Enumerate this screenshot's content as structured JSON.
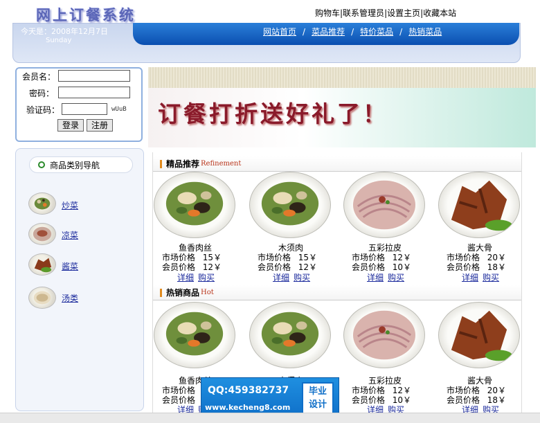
{
  "header": {
    "logo_text": "网上订餐系统",
    "top_links": [
      "购物车",
      "|联系管理员",
      "|设置主页",
      "|收藏本站"
    ],
    "date_text": "今天是：2008年12月7日",
    "weekday": "Sunday",
    "nav": [
      "网站首页",
      "菜品推荐",
      "特价菜品",
      "热销菜品"
    ],
    "nav_sep": "/"
  },
  "login": {
    "member_label": "会员名：",
    "password_label": "密码：",
    "captcha_label": "验证码：",
    "captcha_code": "wUuB",
    "member_value": "",
    "password_value": "",
    "captcha_value": "",
    "login_button": "登录",
    "register_button": "注册"
  },
  "categories": {
    "title": "商品类别导航",
    "items": [
      {
        "label": "炒菜",
        "icon": "stir-fry-dish-icon"
      },
      {
        "label": "凉菜",
        "icon": "cold-dish-icon"
      },
      {
        "label": "酱菜",
        "icon": "braised-dish-icon"
      },
      {
        "label": "汤类",
        "icon": "soup-bowl-icon"
      }
    ]
  },
  "banner": {
    "text": "订餐打折送好礼了！"
  },
  "featured": {
    "title": "精品推荐",
    "title_en": "Refinement",
    "products": [
      {
        "name": "鱼香肉丝",
        "market_label": "市场价格",
        "market_price": "15￥",
        "member_label": "会员价格",
        "member_price": "12￥",
        "detail": "详细",
        "buy": "购买",
        "image": "stir-fry"
      },
      {
        "name": "木须肉",
        "market_label": "市场价格",
        "market_price": "15￥",
        "member_label": "会员价格",
        "member_price": "12￥",
        "detail": "详细",
        "buy": "购买",
        "image": "stir-fry"
      },
      {
        "name": "五彩拉皮",
        "market_label": "市场价格",
        "market_price": "12￥",
        "member_label": "会员价格",
        "member_price": "10￥",
        "detail": "详细",
        "buy": "购买",
        "image": "noodle"
      },
      {
        "name": "酱大骨",
        "market_label": "市场价格",
        "market_price": "20￥",
        "member_label": "会员价格",
        "member_price": "18￥",
        "detail": "详细",
        "buy": "购买",
        "image": "bones"
      }
    ]
  },
  "hot": {
    "title": "热销商品",
    "title_en": "Hot",
    "products": [
      {
        "name": "鱼香肉丝",
        "market_label": "市场价格",
        "market_price": "15￥",
        "member_label": "会员价格",
        "member_price": "12￥",
        "detail": "详细",
        "buy": "购买",
        "image": "stir-fry"
      },
      {
        "name": "木须肉",
        "market_label": "市场价格",
        "market_price": "15￥",
        "member_label": "会员价格",
        "member_price": "12￥",
        "detail": "详细",
        "buy": "购买",
        "image": "stir-fry"
      },
      {
        "name": "五彩拉皮",
        "market_label": "市场价格",
        "market_price": "12￥",
        "member_label": "会员价格",
        "member_price": "10￥",
        "detail": "详细",
        "buy": "购买",
        "image": "noodle"
      },
      {
        "name": "酱大骨",
        "market_label": "市场价格",
        "market_price": "20￥",
        "member_label": "会员价格",
        "member_price": "18￥",
        "detail": "详细",
        "buy": "购买",
        "image": "bones"
      }
    ]
  },
  "watermark": {
    "qq": "QQ:459382737",
    "url": "www.kecheng8.com",
    "badge_line1": "毕业",
    "badge_line2": "设计"
  },
  "colors": {
    "nav_blue": "#0b4fb0",
    "link_blue": "#1b2a9c",
    "banner_red": "#8a1a2a",
    "section_accent": "#e08a1e"
  }
}
